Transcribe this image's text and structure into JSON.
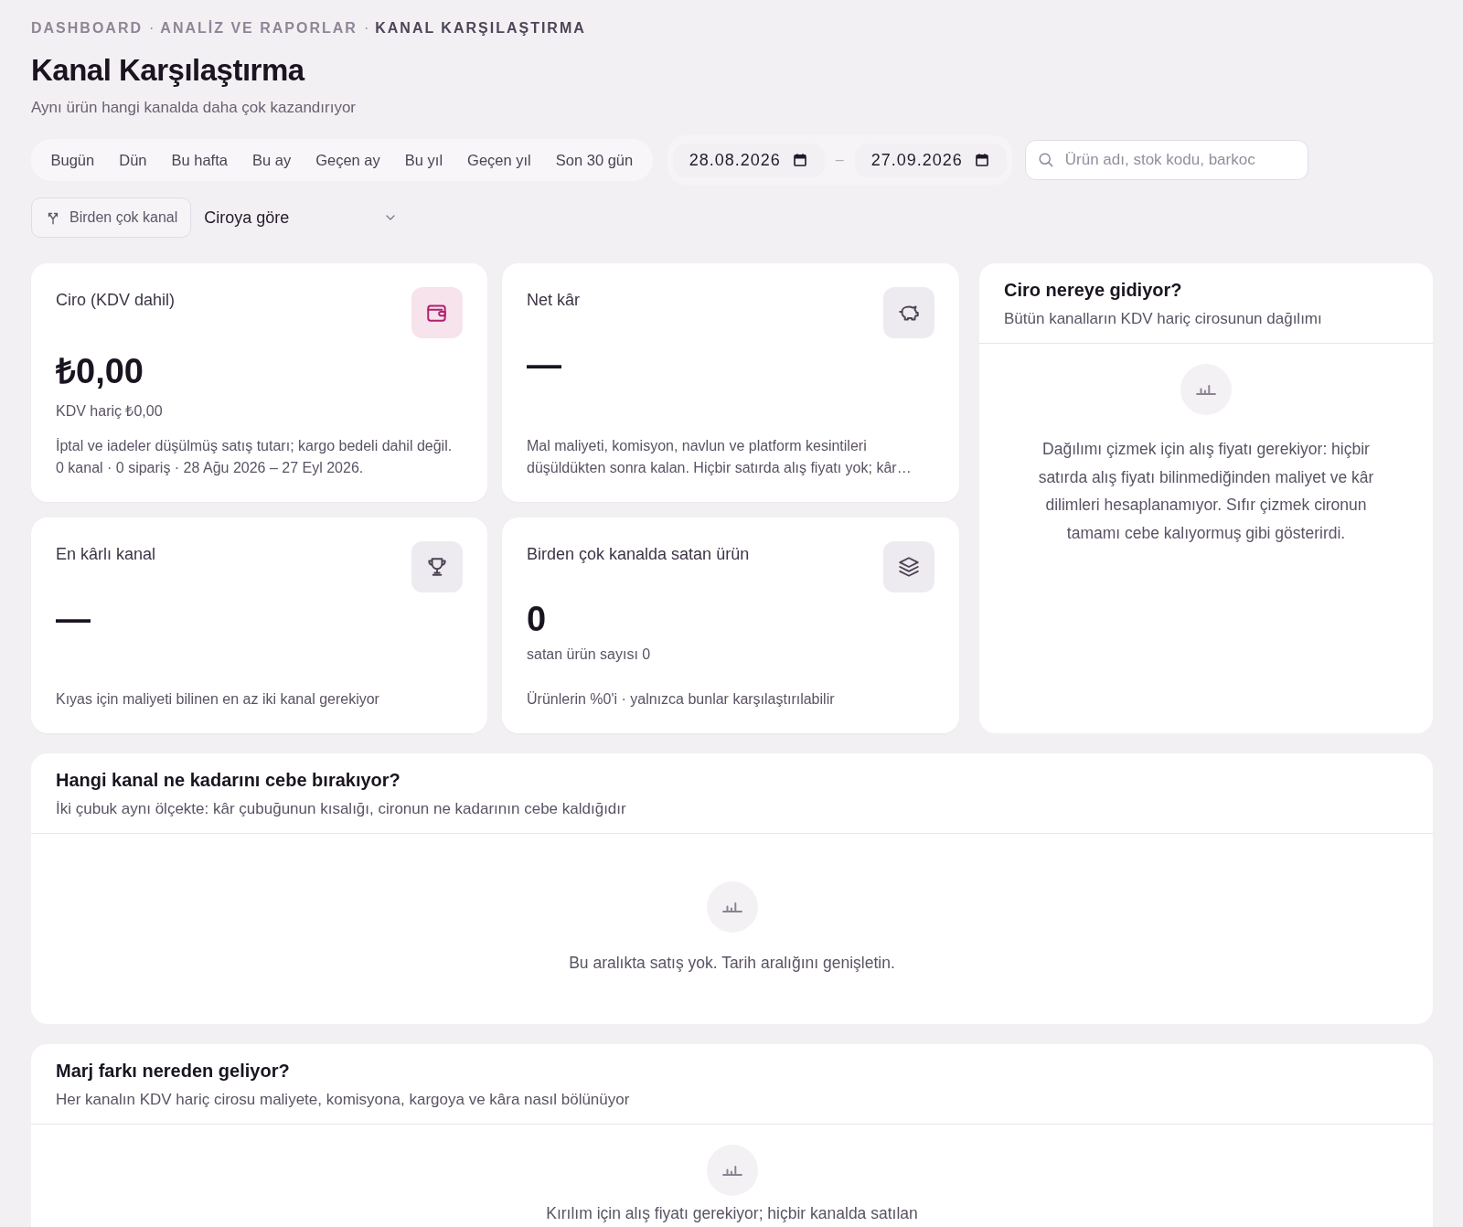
{
  "breadcrumb": [
    {
      "label": "DASHBOARD",
      "current": false
    },
    {
      "label": "ANALİZ VE RAPORLAR",
      "current": false
    },
    {
      "label": "KANAL KARŞILAŞTIRMA",
      "current": true
    }
  ],
  "breadcrumb_separator": "·",
  "title": "Kanal Karşılaştırma",
  "subtitle": "Aynı ürün hangi kanalda daha çok kazandırıyor",
  "range_presets": [
    "Bugün",
    "Dün",
    "Bu hafta",
    "Bu ay",
    "Geçen ay",
    "Bu yıl",
    "Geçen yıl",
    "Son 30 gün"
  ],
  "date_range": {
    "start": "28.08.2026",
    "separator": "–",
    "end": "27.09.2026"
  },
  "search": {
    "placeholder": "Ürün adı, stok kodu, barkoc"
  },
  "multi_channel_button": "Birden çok kanal",
  "sort_select": {
    "value": "Ciroya göre"
  },
  "stat_cards": [
    {
      "label": "Ciro (KDV dahil)",
      "kind": "accent",
      "value": "₺0,00",
      "sub": "KDV hariç ₺0,00",
      "note": "İptal ve iadeler düşülmüş satış tutarı; kargo bedeli dahil değil. 0 kanal · 0 sipariş · 28 Ağu 2026 – 27 Eyl 2026."
    },
    {
      "label": "Net kâr",
      "kind": "neutral",
      "value": "—",
      "note": "Mal maliyeti, komisyon, navlun ve platform kesintileri düşüldükten sonra kalan. Hiçbir satırda alış fiyatı yok; kâr…"
    },
    {
      "label": "En kârlı kanal",
      "kind": "neutral",
      "value": "—",
      "note": "Kıyas için maliyeti bilinen en az iki kanal gerekiyor"
    },
    {
      "label": "Birden çok kanalda satan ürün",
      "kind": "neutral",
      "value": "0",
      "sub": "satan ürün sayısı 0",
      "note": "Ürünlerin %0'i · yalnızca bunlar karşılaştırılabilir"
    }
  ],
  "panels": [
    {
      "title": "Ciro nereye gidiyor?",
      "subtitle": "Bütün kanalların KDV hariç cirosunun dağılımı",
      "empty_message": "Dağılımı çizmek için alış fiyatı gerekiyor: hiçbir satırda alış fiyatı bilinmediğinden maliyet ve kâr dilimleri hesaplanamıyor. Sıfır çizmek cironun tamamı cebe kalıyormuş gibi gösterirdi."
    },
    {
      "title": "Hangi kanal ne kadarını cebe bırakıyor?",
      "subtitle": "İki çubuk aynı ölçekte: kâr çubuğunun kısalığı, cironun ne kadarının cebe kaldığıdır",
      "empty_message": "Bu aralıkta satış yok. Tarih aralığını genişletin."
    },
    {
      "title": "Marj farkı nereden geliyor?",
      "subtitle": "Her kanalın KDV hariç cirosu maliyete, komisyona, kargoya ve kâra nasıl bölünüyor",
      "empty_message": "Kırılım için alış fiyatı gerekiyor; hiçbir kanalda satılan"
    }
  ]
}
